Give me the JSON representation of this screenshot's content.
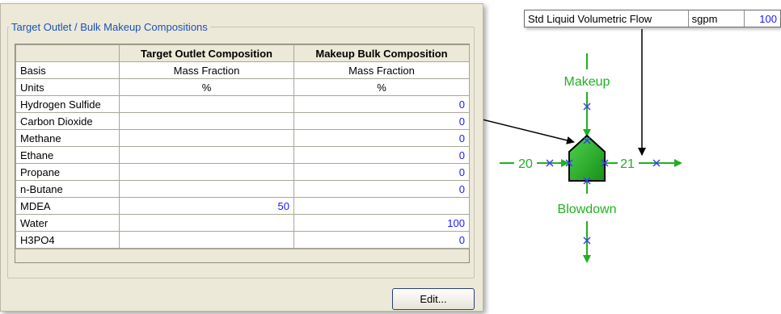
{
  "panel": {
    "group_title": "Target Outlet / Bulk Makeup Compositions",
    "table": {
      "columns": [
        "",
        "Target Outlet Composition",
        "Makeup Bulk Composition"
      ],
      "rows": [
        {
          "label": "Basis",
          "target": "Mass Fraction",
          "makeup": "Mass Fraction"
        },
        {
          "label": "Units",
          "target": "%",
          "makeup": "%"
        },
        {
          "label": "Hydrogen Sulfide",
          "target": "",
          "makeup": "0"
        },
        {
          "label": "Carbon Dioxide",
          "target": "",
          "makeup": "0"
        },
        {
          "label": "Methane",
          "target": "",
          "makeup": "0"
        },
        {
          "label": "Ethane",
          "target": "",
          "makeup": "0"
        },
        {
          "label": "Propane",
          "target": "",
          "makeup": "0"
        },
        {
          "label": "n-Butane",
          "target": "",
          "makeup": "0"
        },
        {
          "label": "MDEA",
          "target": "50",
          "makeup": ""
        },
        {
          "label": "Water",
          "target": "",
          "makeup": "100"
        },
        {
          "label": "H3PO4",
          "target": "",
          "makeup": "0"
        }
      ]
    },
    "edit_button": "Edit..."
  },
  "property_row": {
    "name": "Std Liquid Volumetric Flow",
    "unit": "sgpm",
    "value": "100"
  },
  "diagram": {
    "makeup_label": "Makeup",
    "blowdown_label": "Blowdown",
    "inlet_stream": "20",
    "outlet_stream": "21",
    "stream_color": "#20b020",
    "node_color": "#3a3aff"
  }
}
